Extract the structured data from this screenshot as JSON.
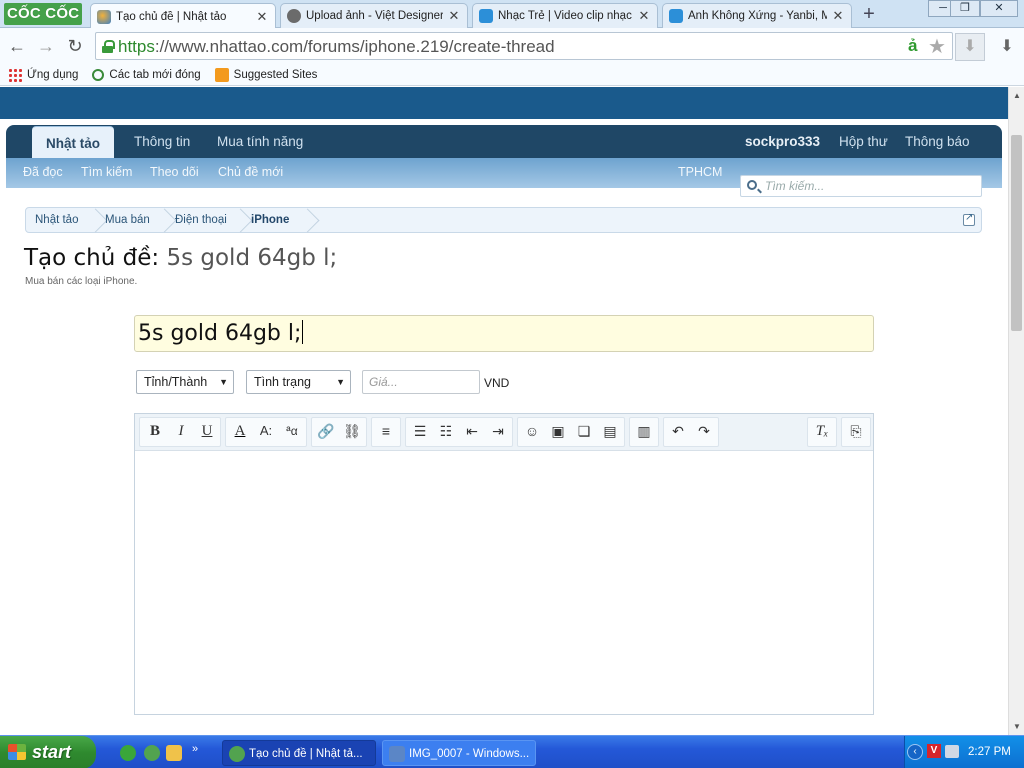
{
  "browser": {
    "brand": "CỐC CỐC",
    "tabs": [
      {
        "title": "Tạo chủ đề | Nhật tảo",
        "active": true,
        "icon": "nhattao-favicon"
      },
      {
        "title": "Upload ảnh - Việt Designer",
        "active": false,
        "icon": "viet-designer-favicon"
      },
      {
        "title": "Nhạc Trẻ | Video clip nhạc trẻ",
        "active": false,
        "icon": "nhaccuatui-favicon"
      },
      {
        "title": "Anh Không Xứng - Yanbi, Mr",
        "active": false,
        "icon": "nhaccuatui-favicon"
      }
    ],
    "url_protocol": "https",
    "url_rest": "://www.nhattao.com/forums/iphone.219/create-thread",
    "bookmarks": [
      "Ứng dụng",
      "Các tab mới đóng",
      "Suggested Sites"
    ]
  },
  "site": {
    "nav_tabs": [
      "Nhật tảo",
      "Thông tin",
      "Mua tính năng"
    ],
    "user": {
      "username": "sockpro333",
      "inbox": "Hộp thư",
      "alerts": "Thông báo"
    },
    "sub_nav": [
      "Đã đọc",
      "Tìm kiếm",
      "Theo dõi",
      "Chủ đề mới"
    ],
    "location": "TPHCM",
    "search_placeholder": "Tìm kiếm..."
  },
  "breadcrumb": [
    "Nhật tảo",
    "Mua bán",
    "Điện thoại",
    "iPhone"
  ],
  "page": {
    "title_prefix": "Tạo chủ đề:",
    "title_subject": "5s gold 64gb l;",
    "description": "Mua bán các loại iPhone."
  },
  "form": {
    "thread_title_value": "5s gold 64gb l;",
    "province_select": "Tỉnh/Thành",
    "condition_select": "Tình trạng",
    "price_placeholder": "Giá...",
    "currency": "VND",
    "editor_content": ""
  },
  "taskbar": {
    "start_label": "start",
    "tasks": [
      "Tạo chủ đề | Nhật tả...",
      "IMG_0007 - Windows..."
    ],
    "clock": "2:27 PM"
  },
  "colors": {
    "site_header": "#1a5a8c",
    "navbar": "#1f4766",
    "subnav": "#84b4dc",
    "title_input_bg": "#fffde0",
    "taskbar": "#2458d8"
  }
}
